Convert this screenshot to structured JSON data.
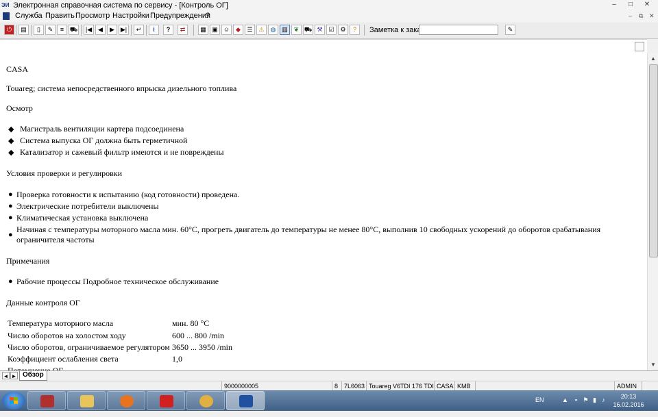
{
  "window": {
    "title": "Электронная справочная система по сервису - [Контроль ОГ]",
    "app_icon_text": "ЭИ",
    "controls": [
      "–",
      "□",
      "✕"
    ],
    "mdi_controls": [
      "–",
      "⧉",
      "✕"
    ]
  },
  "menu": [
    "Служба",
    "Править",
    "Просмотр",
    "Настройки",
    "Предупреждения",
    "?"
  ],
  "toolbar": {
    "order_label": "Заметка к заказу:",
    "order_value": ""
  },
  "document": {
    "heading": "CASA",
    "subtitle": "Touareg; система непосредственного впрыска дизельного топлива",
    "inspection": {
      "title": "Осмотр",
      "items": [
        "Магистраль вентиляции картера подсоединена",
        "Система выпуска ОГ должна быть герметичной",
        "Катализатор и сажевый фильтр имеются и не повреждены"
      ]
    },
    "conditions": {
      "title": "Условия проверки и регулировки",
      "items": [
        "Проверка готовности к испытанию (код готовности) проведена.",
        "Электрические потребители выключены",
        "Климатическая установка выключена",
        "Начиная с температуры моторного масла мин. 60°C, прогреть двигатель до температуры не менее 80°C, выполнив 10 свободных ускорений до оборотов срабатывания",
        "ограничителя частоты"
      ]
    },
    "notes": {
      "title": "Примечания",
      "items": [
        "Рабочие процессы Подробное техническое обслуживание"
      ]
    },
    "data": {
      "title": "Данные контроля ОГ",
      "rows": [
        {
          "label": "Температура моторного масла",
          "value": "мин. 80  °C"
        },
        {
          "label": "Число оборотов на холостом ходу",
          "value": "600  ...  800   /min"
        },
        {
          "label": "Число оборотов, ограничиваемое регулятором",
          "value": "3650  ...  3950   /min"
        },
        {
          "label": "Коэффициент ослабления света",
          "value": "1,0"
        },
        {
          "label": "Потемнение ОГ",
          "value": ""
        }
      ]
    }
  },
  "tabs": {
    "nav": [
      "◄",
      "►"
    ],
    "active": "Обзор"
  },
  "status": [
    "9000000005",
    "8",
    "7L6063",
    "Touareg V6TDI 176 TDI",
    "CASA",
    "KMB",
    "ADMIN"
  ],
  "taskbar": {
    "lang": "EN",
    "time": "20:13",
    "date": "16.02.2016",
    "apps": [
      {
        "name": "installer",
        "color": "#b03030"
      },
      {
        "name": "file-explorer",
        "color": "#e7c55a"
      },
      {
        "name": "firefox",
        "color": "#e8731f"
      },
      {
        "name": "pdf-reader",
        "color": "#d02020"
      },
      {
        "name": "paint",
        "color": "#e0b040"
      },
      {
        "name": "elsa",
        "color": "#2050a0"
      }
    ]
  }
}
